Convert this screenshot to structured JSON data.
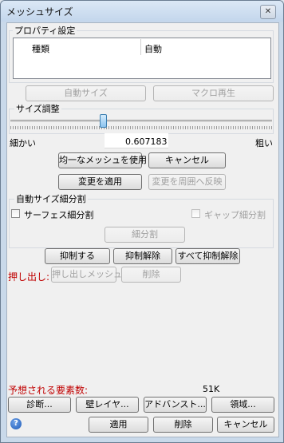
{
  "window": {
    "title": "メッシュサイズ",
    "close_glyph": "✕"
  },
  "properties": {
    "group_label": "プロパティ設定",
    "columns": [
      "種類",
      "自動"
    ],
    "auto_size_button": "自動サイズ",
    "macro_button": "マクロ再生"
  },
  "size_adjust": {
    "group_label": "サイズ調整",
    "fine_label": "細かい",
    "coarse_label": "粗い",
    "value": "0.607183",
    "slider_level": 0.35,
    "uniform_button": "均一なメッシュを使用",
    "cancel_button": "キャンセル",
    "apply_change_button": "変更を適用",
    "reflect_button": "変更を周囲へ反映"
  },
  "auto_refine": {
    "group_label": "自動サイズ細分割",
    "surface_label": "サーフェス細分割",
    "gap_label": "ギャップ細分割",
    "refine_button": "細分割"
  },
  "suppress": {
    "suppress_button": "抑制する",
    "unsuppress_button": "抑制解除",
    "unsuppress_all_button": "すべて抑制解除"
  },
  "extrude": {
    "label": "押し出し:",
    "extrude_mesh_button": "押し出しメッシュ",
    "delete_button": "削除"
  },
  "footer": {
    "expected_label": "予想される要素数:",
    "expected_value": "51K",
    "diagnose_button": "診断...",
    "wall_layer_button": "壁レイヤ...",
    "advanced_button": "アドバンスト...",
    "region_button": "領域...",
    "help_glyph": "?",
    "apply_button": "適用",
    "delete_button": "削除",
    "cancel_button": "キャンセル"
  }
}
